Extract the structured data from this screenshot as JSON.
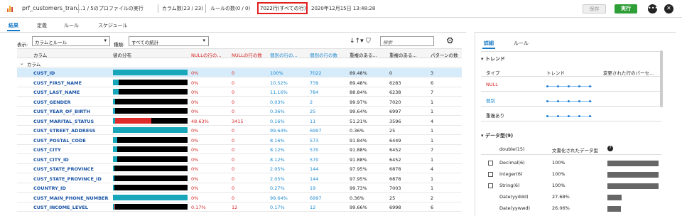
{
  "header": {
    "title": "prf_customers_tran...",
    "run_info": "1 / 5のプロファイルの実行",
    "column_count": "カラム数(23 / 23)",
    "rule_count": "ルールの数(0 / 0)",
    "row_count": "7022行(すべての行)",
    "timestamp": "2020年12月15日 13:48:28",
    "save_label": "保存",
    "run_label": "実行",
    "more_icon": "•••",
    "close_icon": "✕"
  },
  "tabs": [
    "結果",
    "定義",
    "ルール",
    "スケジュール"
  ],
  "toolbar": {
    "display_label": "表示:",
    "display_value": "カラムとルール",
    "type_label": "種類:",
    "type_value": "すべての統計",
    "search_placeholder": "検索",
    "sort_icon": "↓↑▾",
    "filter_icon": "⛉",
    "settings_icon": "⚙"
  },
  "table": {
    "columns": [
      "カラム",
      "値の分布",
      "NULLの行の...",
      "NULLの行の数",
      "個別の行の...",
      "個別の行の数",
      "重複のある...",
      "重複のある...",
      "パターンの数"
    ],
    "group_label": "カラム",
    "rows": [
      {
        "name": "CUST_ID",
        "dist_cyan": 100,
        "dist_red": 0,
        "null_pct": "0%",
        "null_count": "0",
        "distinct_pct": "100%",
        "distinct_count": "7022",
        "dup_pct": "89.48%",
        "dup_count": "0",
        "pattern_count": "3",
        "selected": true
      },
      {
        "name": "CUST_FIRST_NAME",
        "dist_cyan": 8,
        "dist_red": 0,
        "null_pct": "0%",
        "null_count": "0",
        "distinct_pct": "10.52%",
        "distinct_count": "739",
        "dup_pct": "89.48%",
        "dup_count": "6283",
        "pattern_count": "6"
      },
      {
        "name": "CUST_LAST_NAME",
        "dist_cyan": 8,
        "dist_red": 0,
        "null_pct": "0%",
        "null_count": "0",
        "distinct_pct": "11.16%",
        "distinct_count": "784",
        "dup_pct": "88.84%",
        "dup_count": "6238",
        "pattern_count": "7"
      },
      {
        "name": "CUST_GENDER",
        "dist_cyan": 3,
        "dist_red": 0,
        "null_pct": "0%",
        "null_count": "0",
        "distinct_pct": "0.03%",
        "distinct_count": "2",
        "dup_pct": "99.97%",
        "dup_count": "7020",
        "pattern_count": "1"
      },
      {
        "name": "CUST_YEAR_OF_BIRTH",
        "dist_cyan": 3,
        "dist_red": 0,
        "null_pct": "0%",
        "null_count": "0",
        "distinct_pct": "0.36%",
        "distinct_count": "25",
        "dup_pct": "99.64%",
        "dup_count": "6997",
        "pattern_count": "1"
      },
      {
        "name": "CUST_MARITAL_STATUS",
        "dist_cyan": 3,
        "dist_red": 48.63,
        "null_pct": "48.63%",
        "null_count": "3415",
        "distinct_pct": "0.16%",
        "distinct_count": "11",
        "dup_pct": "51.21%",
        "dup_count": "3596",
        "pattern_count": "4"
      },
      {
        "name": "CUST_STREET_ADDRESS",
        "dist_cyan": 100,
        "dist_red": 0,
        "null_pct": "0%",
        "null_count": "0",
        "distinct_pct": "99.64%",
        "distinct_count": "6997",
        "dup_pct": "0.36%",
        "dup_count": "25",
        "pattern_count": "1"
      },
      {
        "name": "CUST_POSTAL_CODE",
        "dist_cyan": 6,
        "dist_red": 0,
        "null_pct": "0%",
        "null_count": "0",
        "distinct_pct": "8.16%",
        "distinct_count": "573",
        "dup_pct": "91.84%",
        "dup_count": "6449",
        "pattern_count": "1"
      },
      {
        "name": "CUST_CITY",
        "dist_cyan": 6,
        "dist_red": 0,
        "null_pct": "0%",
        "null_count": "0",
        "distinct_pct": "8.12%",
        "distinct_count": "570",
        "dup_pct": "91.88%",
        "dup_count": "6452",
        "pattern_count": "7"
      },
      {
        "name": "CUST_CITY_ID",
        "dist_cyan": 6,
        "dist_red": 0,
        "null_pct": "0%",
        "null_count": "0",
        "distinct_pct": "8.12%",
        "distinct_count": "570",
        "dup_pct": "91.88%",
        "dup_count": "6452",
        "pattern_count": "1"
      },
      {
        "name": "CUST_STATE_PROVINCE",
        "dist_cyan": 2,
        "dist_red": 0,
        "null_pct": "0%",
        "null_count": "0",
        "distinct_pct": "2.05%",
        "distinct_count": "144",
        "dup_pct": "97.95%",
        "dup_count": "6878",
        "pattern_count": "4"
      },
      {
        "name": "CUST_STATE_PROVINCE_ID",
        "dist_cyan": 2,
        "dist_red": 0,
        "null_pct": "0%",
        "null_count": "0",
        "distinct_pct": "2.05%",
        "distinct_count": "144",
        "dup_pct": "97.95%",
        "dup_count": "6878",
        "pattern_count": "1"
      },
      {
        "name": "COUNTRY_ID",
        "dist_cyan": 2,
        "dist_red": 0,
        "null_pct": "0%",
        "null_count": "0",
        "distinct_pct": "0.27%",
        "distinct_count": "19",
        "dup_pct": "99.73%",
        "dup_count": "7003",
        "pattern_count": "1"
      },
      {
        "name": "CUST_MAIN_PHONE_NUMBER",
        "dist_cyan": 100,
        "dist_red": 0,
        "null_pct": "0%",
        "null_count": "0",
        "distinct_pct": "99.64%",
        "distinct_count": "6997",
        "dup_pct": "0.36%",
        "dup_count": "25",
        "pattern_count": "2"
      },
      {
        "name": "CUST_INCOME_LEVEL",
        "dist_cyan": 2,
        "dist_red": 0.17,
        "null_pct": "0.17%",
        "null_count": "12",
        "distinct_pct": "0.17%",
        "distinct_count": "12",
        "dup_pct": "99.66%",
        "dup_count": "6998",
        "pattern_count": "6"
      }
    ]
  },
  "details": {
    "tabs": [
      "詳細",
      "ルール"
    ],
    "trend_title": "トレンド",
    "trend_headers": [
      "タイプ",
      "トレンド",
      "変更された行のパーセ..."
    ],
    "trends": [
      {
        "label": "NULL",
        "color": "#d62727"
      },
      {
        "label": "個別",
        "color": "#1d8bd1"
      },
      {
        "label": "重複あり",
        "color": "#222222"
      }
    ],
    "datatype_title": "データ型(9)",
    "datatype_header_col": "double(15)",
    "datatype_header_value": "文書化されたデータ型",
    "datatypes": [
      {
        "label": "Decimal(6)",
        "value": "100%",
        "checkbox": true
      },
      {
        "label": "Integer(6)",
        "value": "100%",
        "checkbox": true
      },
      {
        "label": "String(6)",
        "value": "100%",
        "checkbox": true
      },
      {
        "label": "Date(yyddd)",
        "value": "27.68%",
        "checkbox": false
      },
      {
        "label": "Date(yywwd)",
        "value": "26.06%",
        "checkbox": false
      }
    ]
  }
}
